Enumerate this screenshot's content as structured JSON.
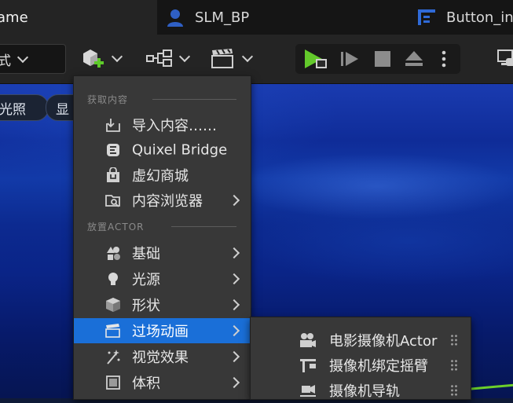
{
  "tabs": [
    {
      "label": "ame",
      "icon": "game-icon",
      "active": true
    },
    {
      "label": "SLM_BP",
      "icon": "blueprint-character-icon",
      "active": false
    },
    {
      "label": "Button_in",
      "icon": "widget-blueprint-icon",
      "active": false
    }
  ],
  "toolbar": {
    "mode_label": "式",
    "add_icon": "add-actor-icon",
    "blueprint_icon": "blueprint-icon",
    "cinematics_icon": "clapperboard-icon",
    "play_icon": "play-icon",
    "advance_icon": "advance-frame-icon",
    "stop_icon": "stop-icon",
    "eject_icon": "eject-icon",
    "more_icon": "more-vertical-icon",
    "platforms_icon": "platforms-icon"
  },
  "viewport": {
    "lighting_label": "光照",
    "show_label": "显"
  },
  "menu": {
    "section_get_content": "获取内容",
    "section_place_actor": "放置ACTOR",
    "items": [
      {
        "label": "导入内容……",
        "icon": "import-icon",
        "submenu": false
      },
      {
        "label": "Quixel Bridge",
        "icon": "bridge-icon",
        "submenu": false
      },
      {
        "label": "虚幻商城",
        "icon": "marketplace-icon",
        "submenu": false
      },
      {
        "label": "内容浏览器",
        "icon": "content-browser-icon",
        "submenu": true
      },
      {
        "label": "基础",
        "icon": "basic-shapes-icon",
        "submenu": true
      },
      {
        "label": "光源",
        "icon": "light-bulb-icon",
        "submenu": true
      },
      {
        "label": "形状",
        "icon": "cube-icon",
        "submenu": true
      },
      {
        "label": "过场动画",
        "icon": "cinematics-icon",
        "submenu": true,
        "selected": true
      },
      {
        "label": "视觉效果",
        "icon": "visual-effects-icon",
        "submenu": true
      },
      {
        "label": "体积",
        "icon": "volume-icon",
        "submenu": true
      }
    ]
  },
  "submenu": {
    "items": [
      {
        "label": "电影摄像机Actor",
        "icon": "cine-camera-icon"
      },
      {
        "label": "摄像机绑定摇臂",
        "icon": "camera-crane-icon"
      },
      {
        "label": "摄像机导轨",
        "icon": "camera-rail-icon"
      }
    ]
  },
  "colors": {
    "accent": "#1a6fd8",
    "menu_bg": "#383838",
    "play_green": "#6ccf2a"
  }
}
